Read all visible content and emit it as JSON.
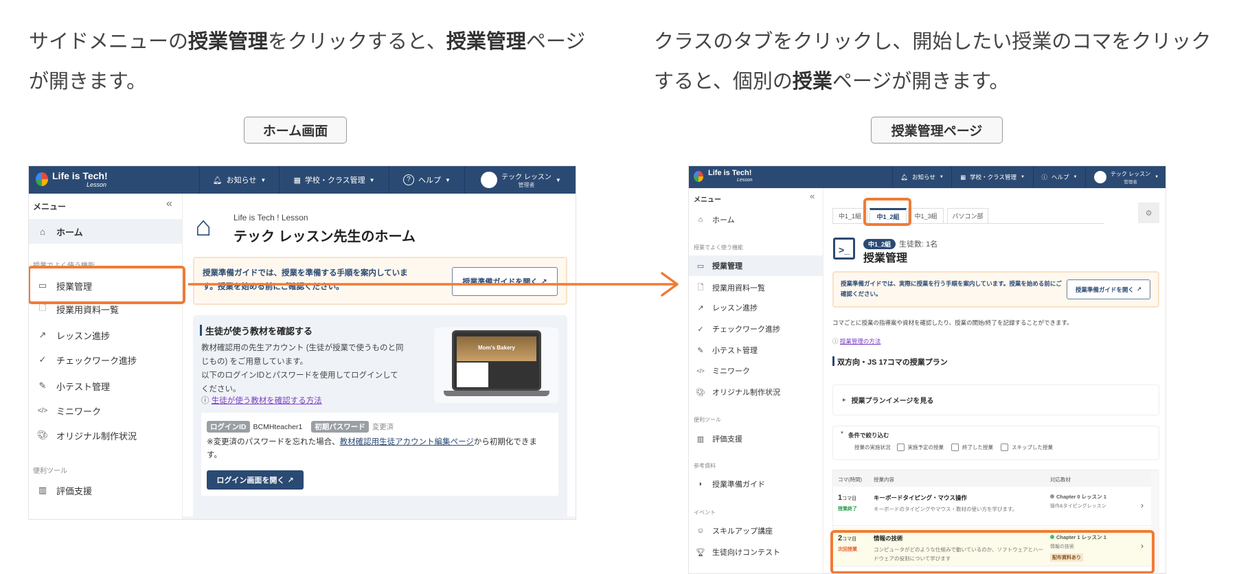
{
  "captions": {
    "left": [
      {
        "t": "サイドメニューの",
        "b": false
      },
      {
        "t": "授業管理",
        "b": true
      },
      {
        "t": "をクリックすると、",
        "b": false
      },
      {
        "t": "授業管理",
        "b": true
      },
      {
        "t": "ページが開きます。",
        "b": false
      }
    ],
    "right": [
      {
        "t": "クラスのタブをクリックし、開始したい授業のコマをクリックすると、個別の",
        "b": false
      },
      {
        "t": "授業",
        "b": true
      },
      {
        "t": "ページが開きます。",
        "b": false
      }
    ],
    "left_label": "ホーム画面",
    "right_label": "授業管理ページ"
  },
  "header": {
    "logo": "Life is Tech!",
    "logo_sub": "Lesson",
    "notices": "お知らせ",
    "school": "学校・クラス管理",
    "help": "ヘルプ",
    "user_name": "テック レッスン",
    "user_role": "管理者"
  },
  "sidebar": {
    "title": "メニュー",
    "collapse": "«",
    "home": "ホーム",
    "section_frequent": "授業でよく使う機能",
    "items": [
      "授業管理",
      "授業用資料一覧",
      "レッスン進捗",
      "チェックワーク進捗",
      "小テスト管理",
      "ミニワーク",
      "オリジナル制作状況"
    ],
    "section_tools": "便利ツール",
    "eval": "評価支援",
    "section_ref": "参考資料",
    "guide": "授業準備ガイド",
    "section_event": "イベント",
    "skillup": "スキルアップ講座",
    "contest": "生徒向けコンテスト"
  },
  "home": {
    "subtitle": "Life is Tech ! Lesson",
    "title": "テック レッスン先生のホーム",
    "notice": "授業準備ガイドでは、授業を準備する手順を案内しています。授業を始める前にご確認ください。",
    "notice_button": "授業準備ガイドを開く",
    "card_title": "生徒が使う教材を確認する",
    "card_text1": "教材確認用の先生アカウント (生徒が授業で使うものと同じもの) をご用意しています。",
    "card_text2": "以下のログインIDとパスワードを使用してログインしてください。",
    "card_link": "生徒が使う教材を確認する方法",
    "laptop_screen": "Mom's Bakery",
    "login_id_label": "ログインID",
    "login_id": "BCMHteacher1",
    "password_label": "初期パスワード",
    "password_status": "変更済",
    "note_prefix": "※変更済のパスワードを忘れた場合、",
    "note_link": "教材確認用生徒アカウント編集ページ",
    "note_suffix": "から初期化できます。",
    "login_button": "ログイン画面を開く"
  },
  "lessons": {
    "tabs": [
      "中1_1組",
      "中1_2組",
      "中1_3組",
      "パソコン部"
    ],
    "active_tab": 1,
    "class_badge": "中1_2組",
    "student_count": "生徒数: 1名",
    "title": "授業管理",
    "notice": "授業準備ガイドでは、実際に授業を行う手順を案内しています。授業を始める前にご確認ください。",
    "notice_button": "授業準備ガイドを開く",
    "description": "コマごとに授業の指導案や資材を確認したり、授業の開始/終了を記録することができます。",
    "help_link": "授業管理の方法",
    "plan_heading": "双方向・JS 17コマの授業プラン",
    "plan_image": "授業プランイメージを見る",
    "filter_title": "条件で絞り込む",
    "filter_label": "授業の実施状況",
    "filters": [
      "実施予定の授業",
      "終了した授業",
      "スキップした授業"
    ],
    "columns": [
      "コマ(時間)",
      "授業内容",
      "対応教材"
    ],
    "rows": [
      {
        "num": "1",
        "unit": "コマ目",
        "status": "授業終了",
        "status_color": "#2e9e4f",
        "title": "キーボードタイピング・マウス操作",
        "desc": "キーボードのタイピングやマウス・教材の使い方を学びます。",
        "chapter": "Chapter 0 レッスン 1",
        "dot": "#a08f84",
        "material": "操作&タイピングレッスン",
        "tag": ""
      },
      {
        "num": "2",
        "unit": "コマ目",
        "status": "次回授業",
        "status_color": "#e8602c",
        "title": "情報の技術",
        "desc": "コンピュータがどのような仕組みで動いているのか、ソフトウェアとハードウェアの役割について学びます",
        "chapter": "Chapter 1 レッスン 1",
        "dot": "#3cbf6b",
        "material": "情報の技術",
        "tag": "配布資料あり"
      }
    ]
  },
  "colors": {
    "navy": "#2b4a73",
    "orange": "#f07b35"
  }
}
